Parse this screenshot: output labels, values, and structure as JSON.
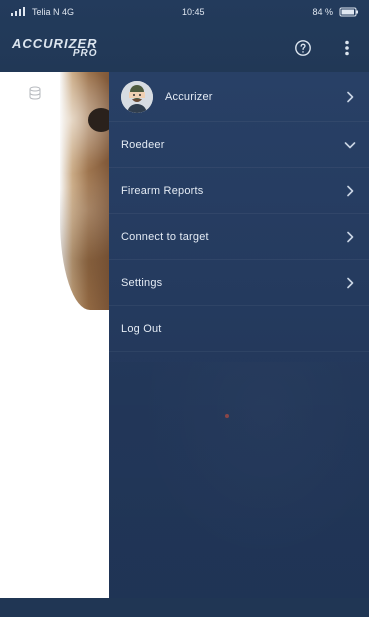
{
  "status_bar": {
    "carrier": "Telia N 4G",
    "time": "10:45",
    "battery_percent": "84 %"
  },
  "app_bar": {
    "brand_main": "ACCURIZER",
    "brand_sub": "PRO",
    "help_icon": "help-circle-icon",
    "more_icon": "vertical-dots-icon"
  },
  "drawer": {
    "profile": {
      "name": "Accurizer",
      "chevron_icon": "chevron-right-icon"
    },
    "items": [
      {
        "label": "Roedeer",
        "chevron_icon": "chevron-down-icon"
      },
      {
        "label": "Firearm Reports",
        "chevron_icon": "chevron-right-icon"
      },
      {
        "label": "Connect to target",
        "chevron_icon": "chevron-right-icon"
      },
      {
        "label": "Settings",
        "chevron_icon": "chevron-right-icon"
      },
      {
        "label": "Log Out",
        "chevron_icon": ""
      }
    ]
  },
  "content": {
    "small_icon": "database-icon"
  },
  "colors": {
    "header_bg": "#233b5c",
    "drawer_bg": "#284066",
    "text_light": "#e7eef7"
  }
}
